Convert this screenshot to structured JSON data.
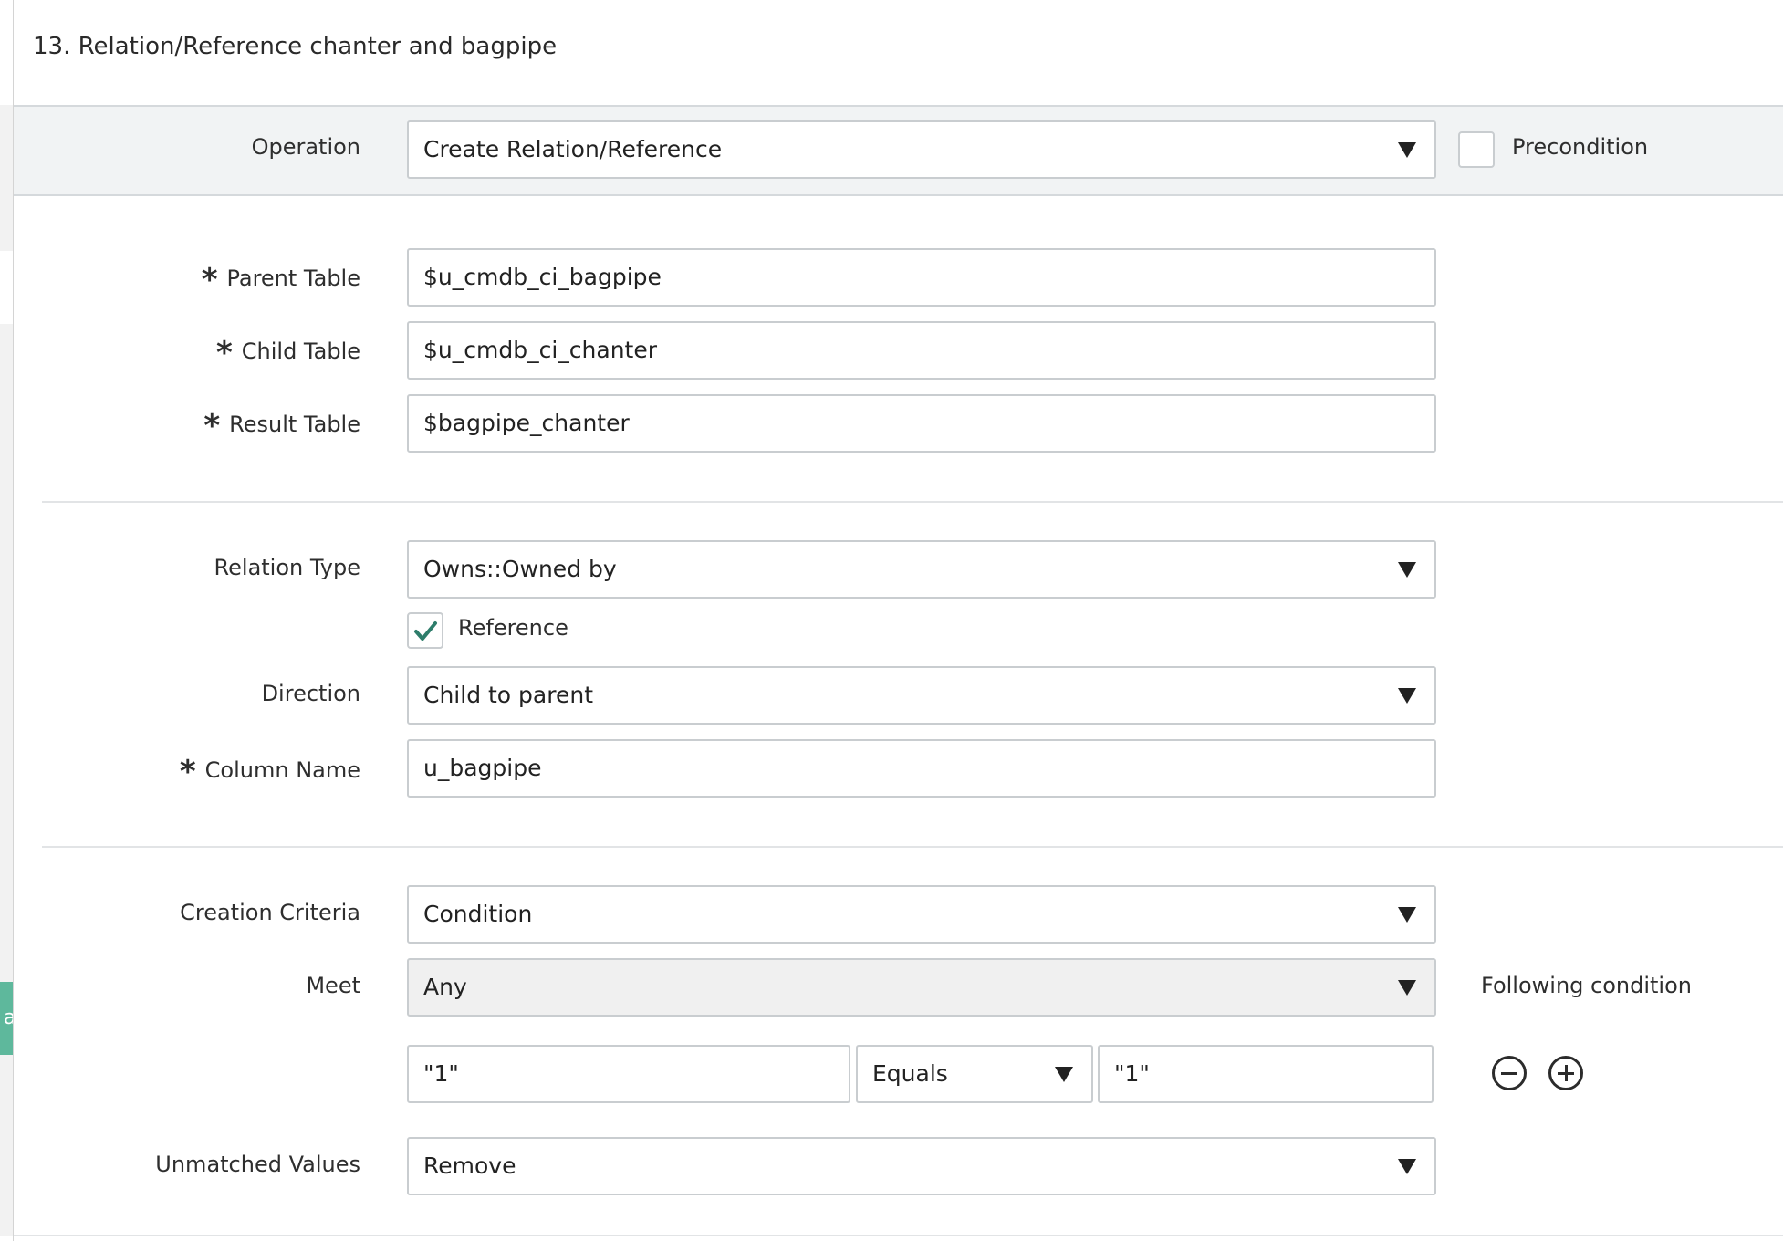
{
  "title": "13. Relation/Reference chanter and bagpipe",
  "side_tab_letter": "a",
  "operation": {
    "label": "Operation",
    "value": "Create Relation/Reference",
    "precondition_label": "Precondition",
    "precondition_checked": false
  },
  "required_marker": "*",
  "parent_table": {
    "label": "Parent Table",
    "value": "$u_cmdb_ci_bagpipe"
  },
  "child_table": {
    "label": "Child Table",
    "value": "$u_cmdb_ci_chanter"
  },
  "result_table": {
    "label": "Result Table",
    "value": "$bagpipe_chanter"
  },
  "relation_type": {
    "label": "Relation Type",
    "value": "Owns::Owned by"
  },
  "reference": {
    "label": "Reference",
    "checked": true
  },
  "direction": {
    "label": "Direction",
    "value": "Child to parent"
  },
  "column_name": {
    "label": "Column Name",
    "value": "u_bagpipe"
  },
  "creation_criteria": {
    "label": "Creation Criteria",
    "value": "Condition"
  },
  "meet": {
    "label": "Meet",
    "value": "Any",
    "following_label": "Following condition"
  },
  "condition_row": {
    "left": "\"1\"",
    "operator": "Equals",
    "right": "\"1\""
  },
  "unmatched_values": {
    "label": "Unmatched Values",
    "value": "Remove"
  },
  "colors": {
    "accent": "#5eb89c",
    "check": "#2e7d6b",
    "band": "#f1f3f4"
  }
}
